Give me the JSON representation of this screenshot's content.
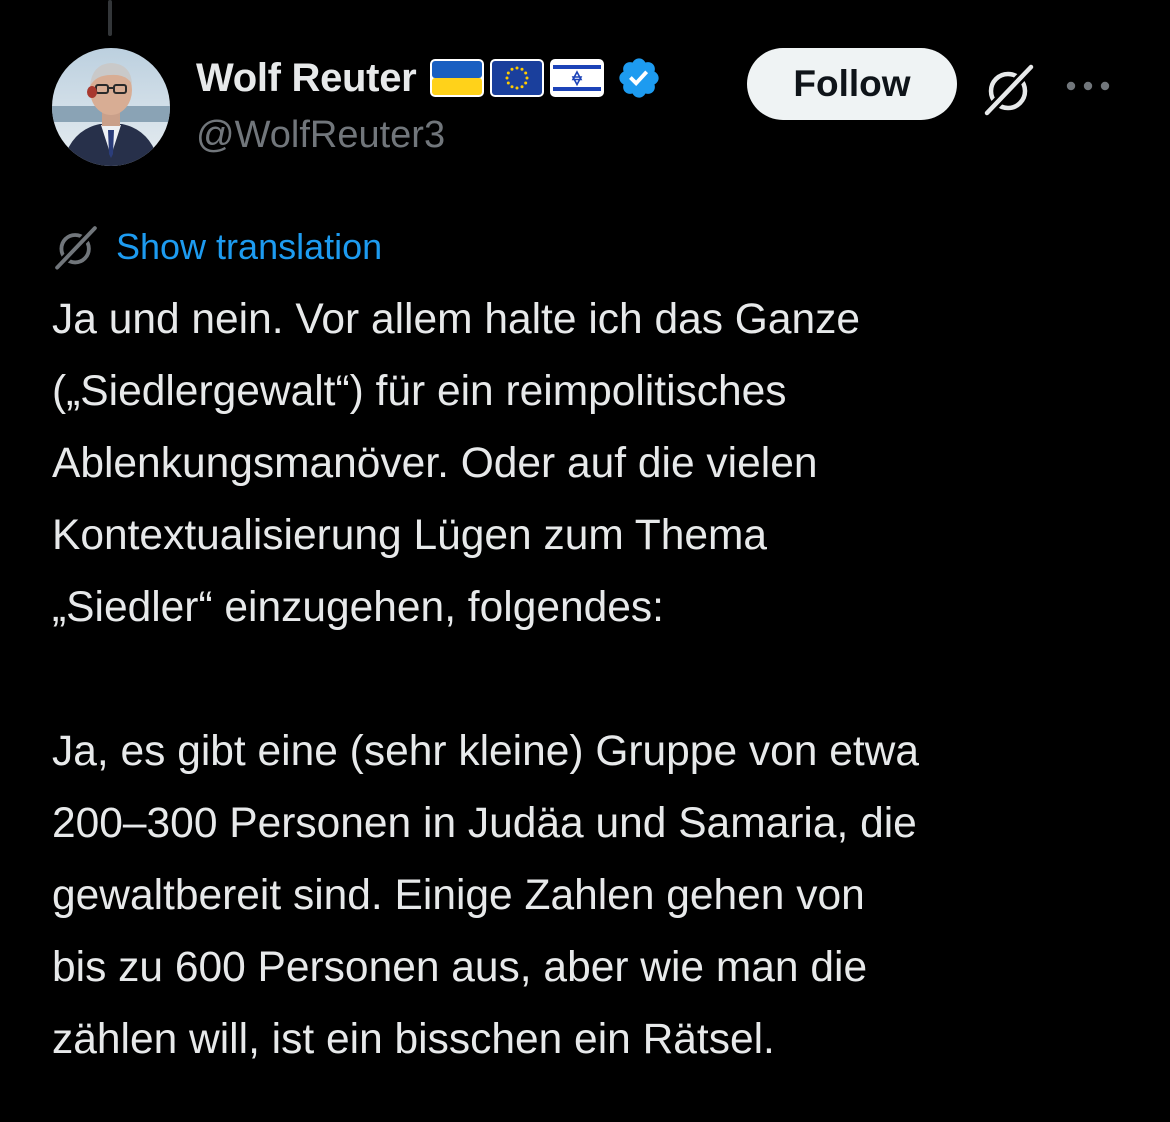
{
  "author": {
    "display_name": "Wolf Reuter",
    "handle": "@WolfReuter3",
    "flags": [
      "ukraine-flag",
      "eu-flag",
      "israel-flag"
    ],
    "verified": true
  },
  "actions": {
    "follow_label": "Follow"
  },
  "translation": {
    "link_label": "Show translation"
  },
  "tweet": {
    "paragraph_1": [
      "Ja und nein. Vor allem halte ich das Ganze",
      "(„Siedlergewalt“) für ein reimpolitisches",
      "Ablenkungsmanöver. Oder auf die vielen",
      "Kontextualisierung Lügen zum Thema",
      "„Siedler“ einzugehen, folgendes:"
    ],
    "paragraph_2": [
      "Ja, es gibt eine (sehr kleine) Gruppe von etwa",
      "200–300 Personen in Judäa und Samaria, die",
      "gewaltbereit sind. Einige Zahlen gehen von",
      "bis zu 600 Personen aus, aber wie man die",
      "zählen will, ist ein bisschen ein Rätsel."
    ]
  },
  "colors": {
    "background": "#000000",
    "text_primary": "#e7e9ea",
    "text_secondary": "#71767b",
    "link": "#1d9bf0",
    "verified": "#1d9bf0",
    "follow_bg": "#eff3f4"
  }
}
